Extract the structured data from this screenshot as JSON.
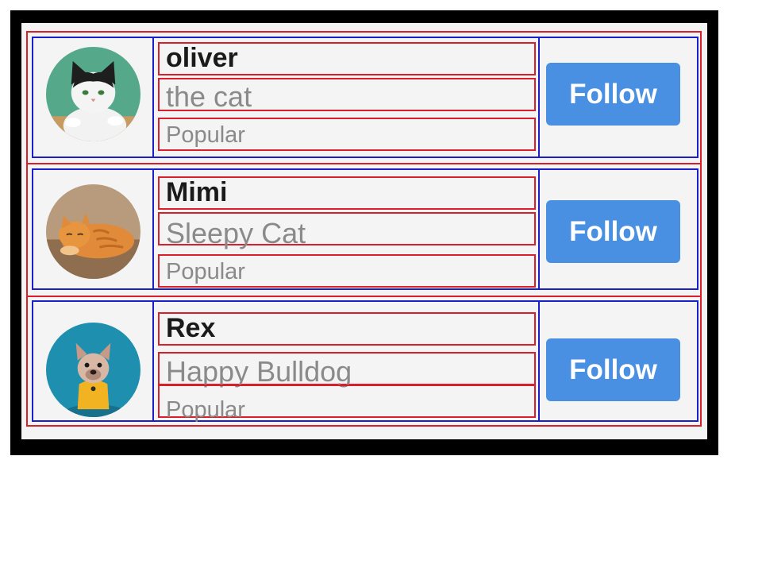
{
  "list": {
    "items": [
      {
        "name": "oliver",
        "subtitle": "the cat",
        "tag": "Popular",
        "button_label": "Follow",
        "avatar_icon": "cat-avatar-icon",
        "avatar_bg": "#55a98a"
      },
      {
        "name": "Mimi",
        "subtitle": "Sleepy Cat",
        "tag": "Popular",
        "button_label": "Follow",
        "avatar_icon": "cat-avatar-icon",
        "avatar_bg": "#a88a6c"
      },
      {
        "name": "Rex",
        "subtitle": "Happy Bulldog",
        "tag": "Popular",
        "button_label": "Follow",
        "avatar_icon": "dog-avatar-icon",
        "avatar_bg": "#1f8fb0"
      }
    ]
  },
  "colors": {
    "button": "#4a90e2",
    "outline_red": "#d81f2a",
    "outline_blue": "#1b1fc9",
    "name_text": "#1a1a1a",
    "secondary_text": "#8a8a8a"
  }
}
